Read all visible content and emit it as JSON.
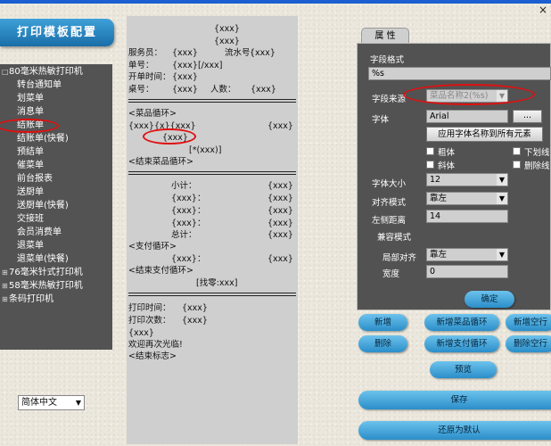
{
  "window": {
    "close": "×"
  },
  "header": {
    "title": "打印模板配置"
  },
  "tree": {
    "items": [
      {
        "label": "80毫米热敏打印机",
        "exp": "□"
      },
      {
        "label": "转台通知单"
      },
      {
        "label": "划菜单"
      },
      {
        "label": "消息单"
      },
      {
        "label": "结账单"
      },
      {
        "label": "结账单(快餐)"
      },
      {
        "label": "预结单"
      },
      {
        "label": "催菜单"
      },
      {
        "label": "前台报表"
      },
      {
        "label": "送厨单"
      },
      {
        "label": "送厨单(快餐)"
      },
      {
        "label": "交接班"
      },
      {
        "label": "会员消费单"
      },
      {
        "label": "退菜单"
      },
      {
        "label": "退菜单(快餐)"
      },
      {
        "label": "76毫米针式打印机",
        "exp": "⊞"
      },
      {
        "label": "58毫米热敏打印机",
        "exp": "⊞"
      },
      {
        "label": "条码打印机",
        "exp": "⊞"
      }
    ]
  },
  "language": {
    "value": "简体中文"
  },
  "preview": {
    "header1": "{xxx}",
    "header2": "{xxx}",
    "waiter_label": "服务员：",
    "waiter_val": "{xxx}",
    "serial_label": "流水号：",
    "serial_val": "{xxx}",
    "order_label": "单号：",
    "order_val": "{xxx}[/xxx]",
    "opentime_label": "开单时间：",
    "opentime_val": "{xxx}",
    "table_label": "桌号：",
    "table_val": "{xxx}",
    "people_label": "人数：",
    "people_val": "{xxx}",
    "dish_loop": "<菜品循环>",
    "dish_row": "{xxx}{x}{xxx}",
    "dish_row_val": "{xxx}",
    "dish_name": "{xxx}",
    "dish_paren": "[*(xxx)]",
    "dish_end": "<结束菜品循环>",
    "subtotal_label": "小计：",
    "subtotal_val": "{xxx}",
    "f1_label": "{xxx}：",
    "f1_val": "{xxx}",
    "f2_label": "{xxx}：",
    "f2_val": "{xxx}",
    "f3_label": "{xxx}：",
    "f3_val": "{xxx}",
    "total_label": "总计：",
    "total_val": "{xxx}",
    "pay_loop": "<支付循环>",
    "pay_label": "{xxx}：",
    "pay_val": "{xxx}",
    "pay_end": "<结束支付循环>",
    "change": "[找零:xxx]",
    "printtime_label": "打印时间：",
    "printtime_val": "{xxx}",
    "printcount_label": "打印次数：",
    "printcount_val": "{xxx}",
    "footer_xxx": "{xxx}",
    "welcome": "欢迎再次光临!",
    "end_mark": "<结束标志>"
  },
  "props": {
    "tab": "属 性",
    "field_format_label": "字段格式",
    "field_format_value": "%s",
    "field_source_label": "字段来源",
    "field_source_value": "菜品名称2(%s)",
    "font_label": "字体",
    "font_value": "Arial",
    "font_btn": "...",
    "apply_font_btn": "应用字体名称到所有元素",
    "bold": "粗体",
    "underline": "下划线",
    "italic": "斜体",
    "strike": "删除线",
    "size_label": "字体大小",
    "size_value": "12",
    "align_label": "对齐模式",
    "align_value": "靠左",
    "left_label": "左侧距离",
    "left_value": "14",
    "compat_label": "兼容模式",
    "local_align_label": "局部对齐",
    "local_align_value": "靠左",
    "width_label": "宽度",
    "width_value": "0",
    "ok_btn": "确定"
  },
  "actions": {
    "add": "新增",
    "add_dish_loop": "新增菜品循环",
    "add_blank_1": "新增空行",
    "delete": "删除",
    "add_pay_loop": "新增支付循环",
    "delete_blank": "删除空行",
    "preview": "预览",
    "save": "保存",
    "restore": "还原为默认"
  }
}
